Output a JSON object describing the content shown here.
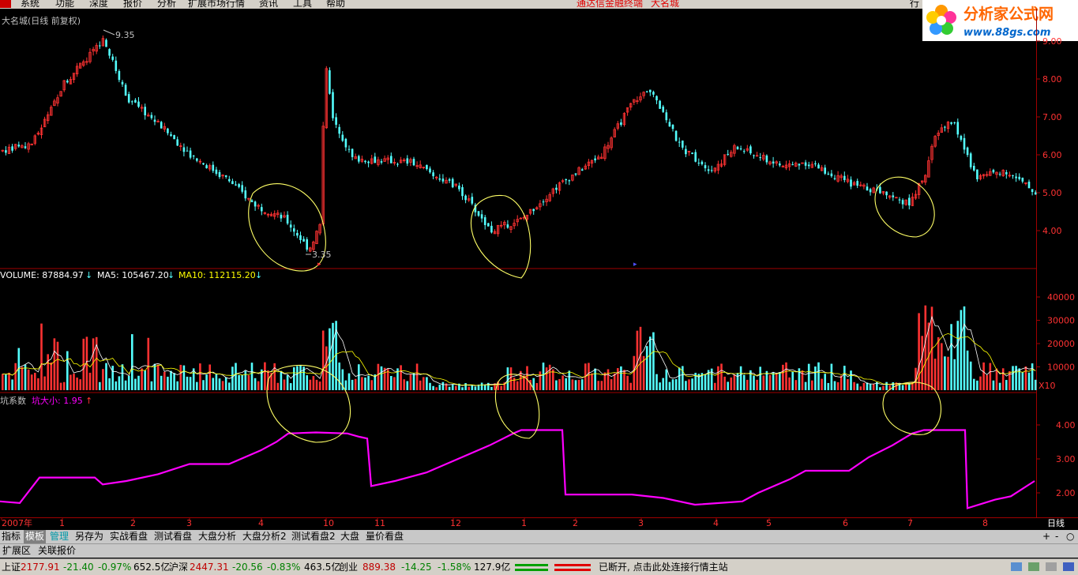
{
  "menu": {
    "items": [
      "系统",
      "功能",
      "深度",
      "报价",
      "分析",
      "扩展市场行情",
      "资讯",
      "工具",
      "帮助"
    ],
    "title": "通达信金融终端",
    "stock": "大名城",
    "right_label": "行"
  },
  "logo": {
    "title": "分析家公式网",
    "url": "www.88gs.com"
  },
  "price_panel": {
    "header": "大名城(日线 前复权)",
    "high_label": "9.35",
    "low_label": "3.35",
    "yticks": [
      "9.00",
      "8.00",
      "7.00",
      "6.00",
      "5.00",
      "4.00"
    ]
  },
  "volume_panel": {
    "label": "VOLUME: 87884.97",
    "ma5": "MA5: 105467.20",
    "ma10": "MA10: 112115.20",
    "yticks": [
      "40000",
      "30000",
      "20000",
      "10000"
    ],
    "unit": "X10"
  },
  "indicator_panel": {
    "label": "坑系数",
    "value_label": "坑大小: 1.95",
    "yticks": [
      "4.00",
      "3.00",
      "2.00"
    ]
  },
  "xaxis": {
    "labels": [
      "2007年",
      "1",
      "2",
      "3",
      "4",
      "10",
      "11",
      "12",
      "1",
      "2",
      "3",
      "4",
      "5",
      "6",
      "7",
      "8"
    ],
    "period": "日线"
  },
  "tabs": [
    "指标",
    "模板",
    "管理",
    "另存为",
    "实战看盘",
    "测试看盘",
    "大盘分析",
    "大盘分析2",
    "测试看盘2",
    "大盘",
    "量价看盘"
  ],
  "tab_controls": [
    "+",
    "-",
    "○"
  ],
  "ext_tabs": [
    "扩展区",
    "关联报价"
  ],
  "status": {
    "sh_name": "上证",
    "sh_val": "2177.91",
    "sh_chg": "-21.40",
    "sh_pct": "-0.97%",
    "sh_amt": "652.5亿",
    "hs_name": "沪深",
    "hs_val": "2447.31",
    "hs_chg": "-20.56",
    "hs_pct": "-0.83%",
    "hs_amt": "463.5亿",
    "cy_name": "创业",
    "cy_val": "889.38",
    "cy_chg": "-14.25",
    "cy_pct": "-1.58%",
    "cy_amt": "127.9亿",
    "message": "已断开, 点击此处连接行情主站"
  },
  "colors": {
    "up": "#ff3232",
    "down": "#54ffff",
    "indicator": "#ff00ff",
    "circle": "#ffff66",
    "ma5": "#ffffff",
    "ma10": "#ffff00"
  }
}
